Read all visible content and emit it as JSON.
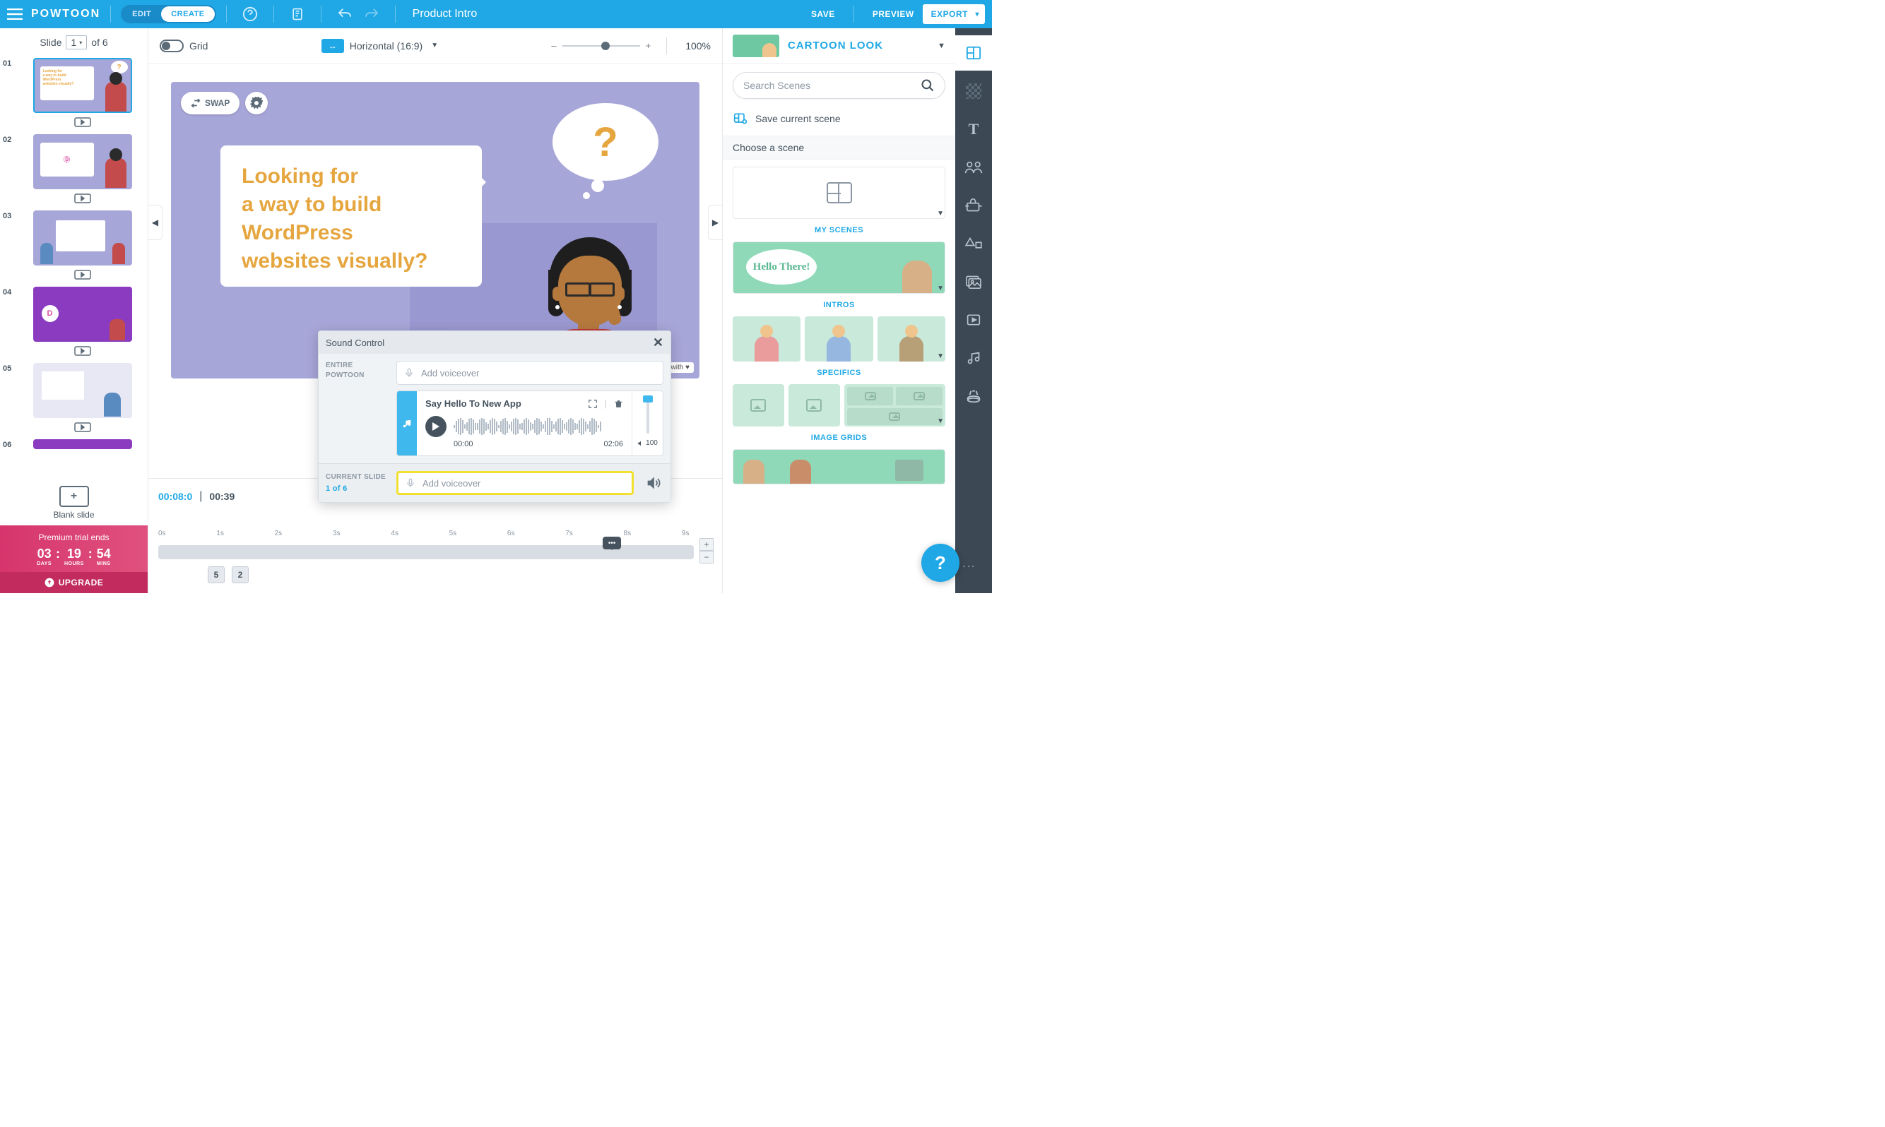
{
  "topbar": {
    "logo": "POWTOON",
    "mode_edit": "EDIT",
    "mode_create": "CREATE",
    "project_title": "Product Intro",
    "save": "SAVE",
    "preview": "PREVIEW",
    "export": "EXPORT"
  },
  "left": {
    "slide_label": "Slide",
    "current_slide": "1",
    "total_label": "of 6",
    "thumbs": [
      "01",
      "02",
      "03",
      "04",
      "05",
      "06"
    ],
    "blank_slide": "Blank slide",
    "trial_title": "Premium trial ends",
    "countdown": {
      "days": "03",
      "days_u": "DAYS",
      "hours": "19",
      "hours_u": "HOURS",
      "mins": "54",
      "mins_u": "MINS"
    },
    "upgrade": "UPGRADE"
  },
  "center_toolbar": {
    "grid": "Grid",
    "aspect_badge": "↔",
    "aspect": "Horizontal (16:9)",
    "zoom_minus": "–",
    "zoom_plus": "+",
    "zoom": "100%"
  },
  "canvas": {
    "swap": "SWAP",
    "speech_text": "Looking for\na way to build\nWordPress\nwebsites visually?",
    "brand_tag": "made with ♥"
  },
  "sound": {
    "title": "Sound Control",
    "entire_label": "ENTIRE POWTOON",
    "add_vo": "Add voiceover",
    "track_name": "Say Hello To New App",
    "t_start": "00:00",
    "t_end": "02:06",
    "volume": "100",
    "current_label": "CURRENT SLIDE",
    "slide_count": "1 of 6"
  },
  "timeline": {
    "current": "00:08:0",
    "total": "00:39",
    "ticks": [
      "0s",
      "1s",
      "2s",
      "3s",
      "4s",
      "5s",
      "6s",
      "7s",
      "8s",
      "9s"
    ],
    "items": [
      "5",
      "2"
    ]
  },
  "right": {
    "look_title": "CARTOON LOOK",
    "search_placeholder": "Search Scenes",
    "save_scene": "Save current scene",
    "choose": "Choose a scene",
    "cat_myscenes": "MY SCENES",
    "hello_bubble": "Hello There!",
    "cat_intros": "INTROS",
    "cat_specifics": "SPECIFICS",
    "cat_imagegrids": "IMAGE GRIDS"
  },
  "rail": {
    "items": [
      "layout",
      "background",
      "text",
      "characters",
      "props",
      "shapes",
      "images",
      "videos",
      "sound",
      "specials"
    ]
  }
}
